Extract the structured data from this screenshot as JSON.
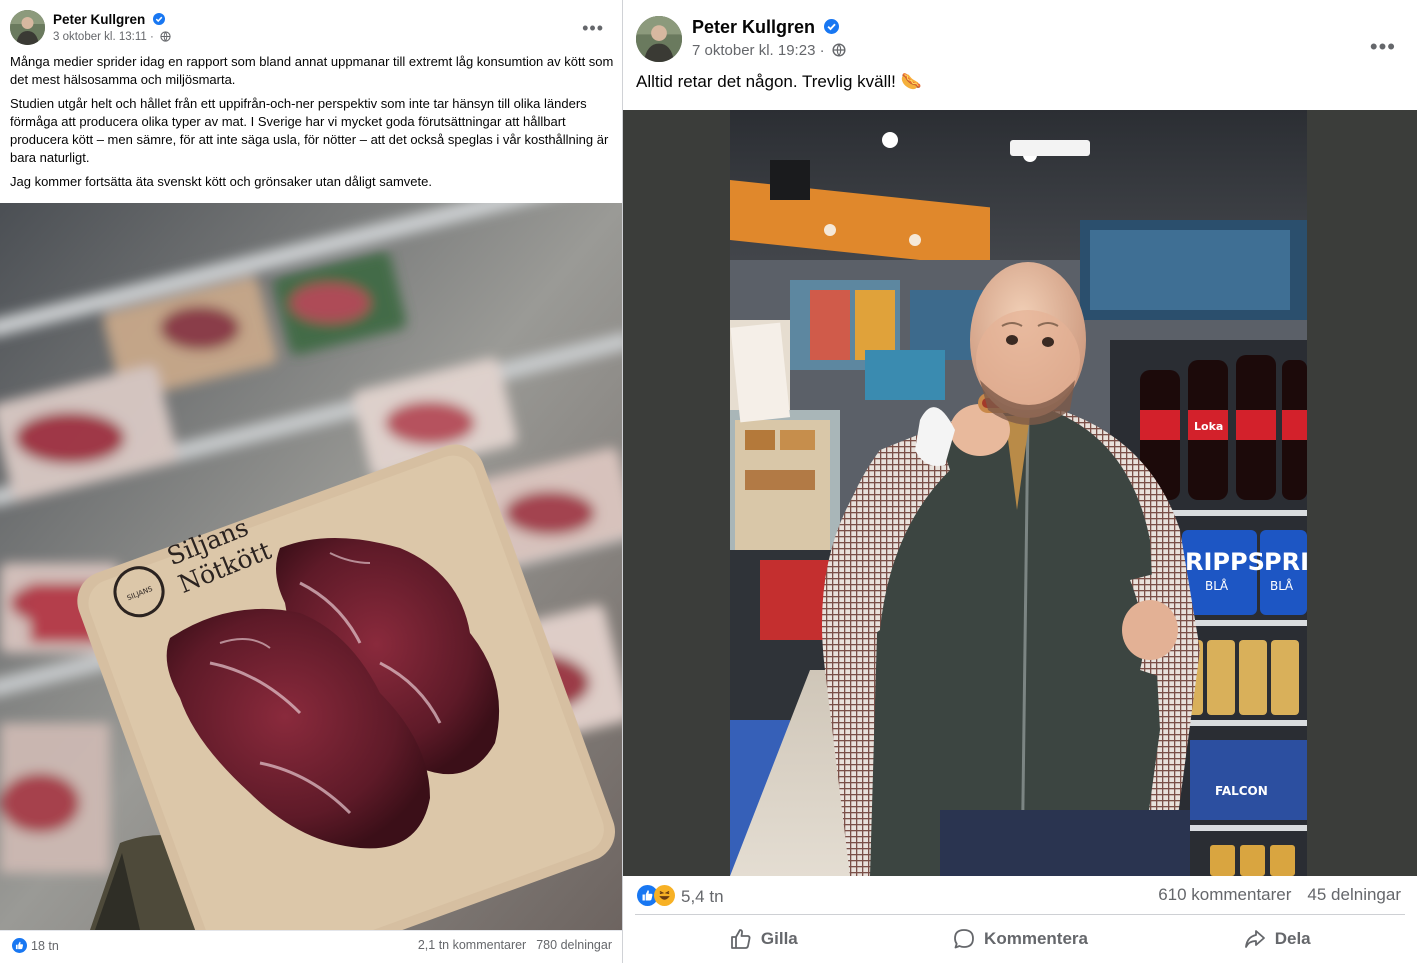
{
  "left_post": {
    "author": "Peter Kullgren",
    "verified_icon": "verified-badge-icon",
    "date": "3 oktober kl. 13:11",
    "privacy_icon": "globe-icon",
    "more_label": "•••",
    "paragraphs": [
      "Många medier sprider idag en rapport som bland annat uppmanar till extremt låg konsumtion av kött som det mest hälsosamma och miljösmarta.",
      "Studien utgår helt och hållet från ett uppifrån-och-ner perspektiv som inte tar hänsyn till olika länders förmåga att producera olika typer av mat. I Sverige har vi mycket goda förutsättningar att hållbart producera kött – men sämre, för att inte säga usla, för nötter – att det också speglas i vår kosthållning är bara naturligt.",
      "Jag kommer fortsätta äta svenskt kött och grönsaker utan dåligt samvete."
    ],
    "photo": {
      "package_brand_line1": "Siljans",
      "package_brand_line2": "Nötkött",
      "package_logo_text": "SILJANS"
    },
    "reactions": "18 tn",
    "comments": "2,1 tn kommentarer",
    "shares": "780 delningar"
  },
  "right_post": {
    "author": "Peter Kullgren",
    "date": "7 oktober kl. 19:23",
    "more_label": "•••",
    "text": "Alltid retar det någon. Trevlig kväll! 🌭",
    "photo": {
      "shelf_sign_1": "RIPPS",
      "shelf_sign_1b": "BLÅ",
      "shelf_sign_2": "PRI",
      "shelf_sign_2b": "BLÅ",
      "bottle_label": "Loka",
      "cooler_label": "FALCON"
    },
    "reactions": "5,4 tn",
    "comments": "610 kommentarer",
    "shares": "45 delningar",
    "actions": {
      "like": "Gilla",
      "comment": "Kommentera",
      "share": "Dela"
    }
  },
  "colors": {
    "facebook_blue": "#1877f2",
    "secondary_text": "#65676b",
    "haha_yellow": "#f7b125"
  }
}
